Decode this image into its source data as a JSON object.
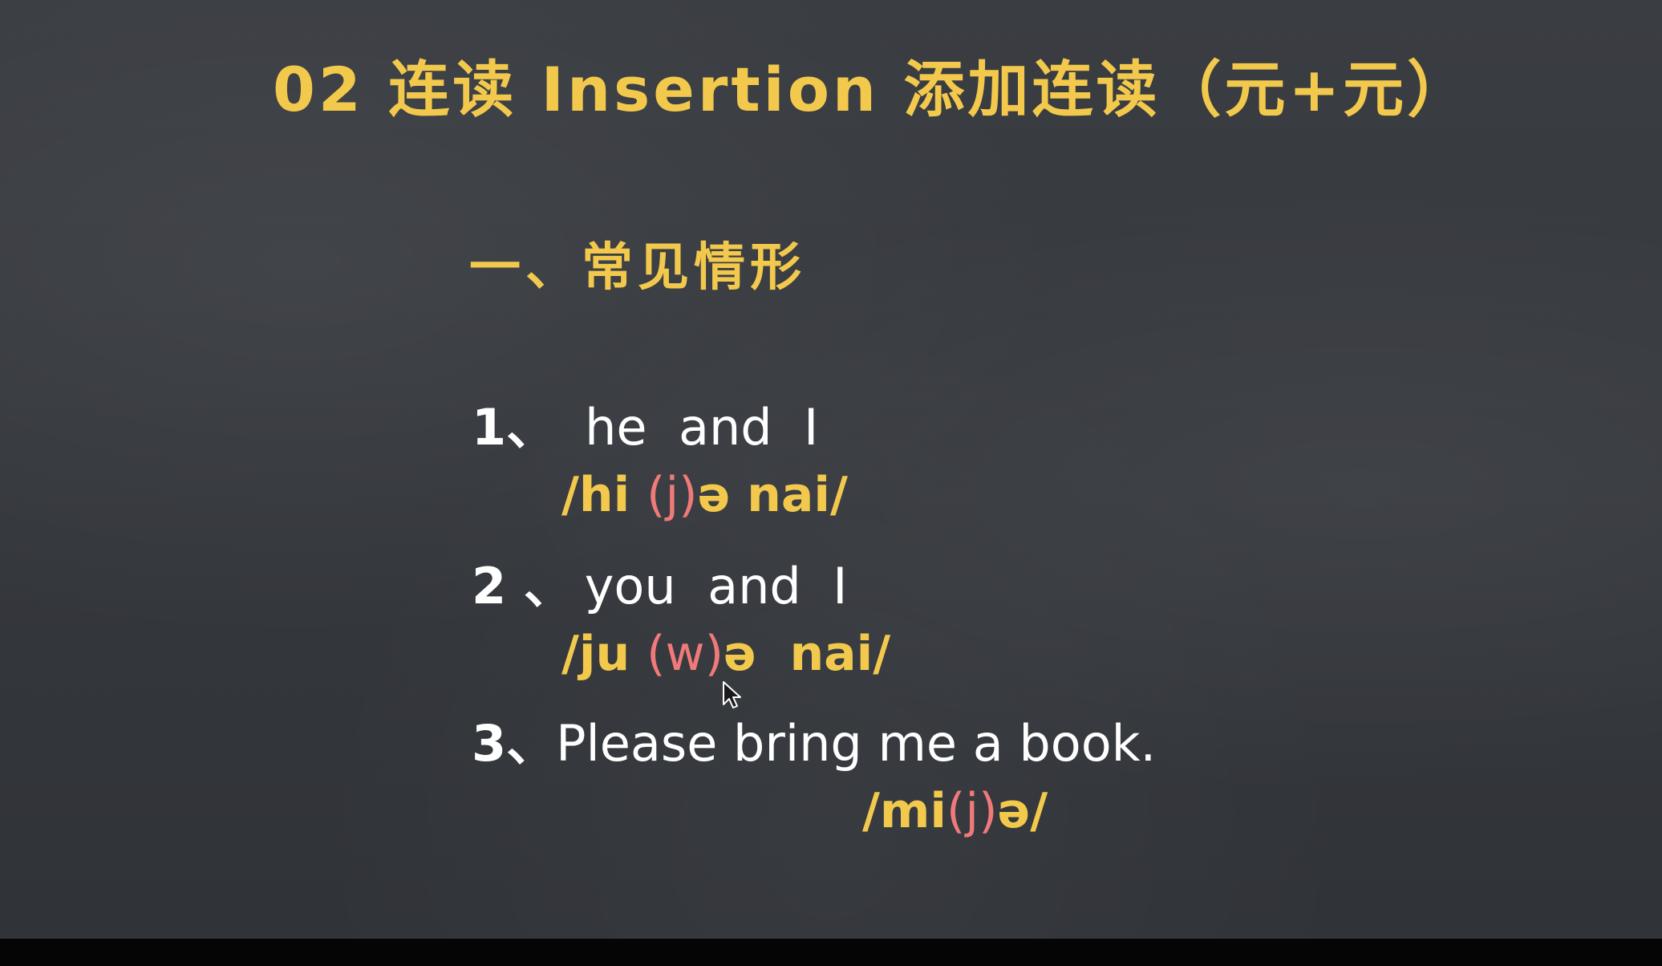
{
  "title": "02 连读 Insertion 添加连读（元+元）",
  "heading": "一、常见情形",
  "items": [
    {
      "number": "1、",
      "phrase": "he  and  I",
      "ipa_pre": "/hi ",
      "ipa_ins": "(j)",
      "ipa_post": "ə nai/"
    },
    {
      "number": "2 、",
      "phrase": "you  and  I",
      "ipa_pre": "/ju ",
      "ipa_ins": "(w)",
      "ipa_post": "ə  nai/"
    },
    {
      "number": "3、",
      "phrase": "Please bring me a book.",
      "ipa_pre": "/mi",
      "ipa_ins": "(j)",
      "ipa_post": "ə/"
    }
  ],
  "colors": {
    "chalk_yellow": "#f2c94c",
    "chalk_white": "#ffffff",
    "chalk_red": "#f07a7a",
    "board": "#35383d"
  },
  "icons": [
    "mouse-cursor-icon"
  ]
}
